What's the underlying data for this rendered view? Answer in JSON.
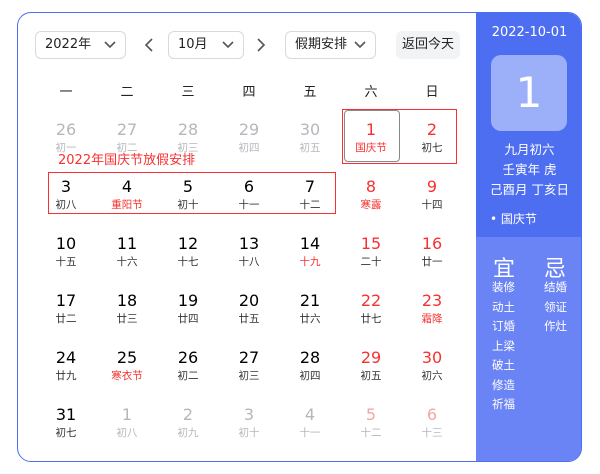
{
  "toolbar": {
    "year": "2022年",
    "month": "10月",
    "holiday_select": "假期安排",
    "today_button": "返回今天"
  },
  "weekdays": [
    "一",
    "二",
    "三",
    "四",
    "五",
    "六",
    "日"
  ],
  "annotation": "2022年国庆节放假安排",
  "weeks": [
    [
      {
        "d": "26",
        "l": "初一",
        "other": true
      },
      {
        "d": "27",
        "l": "初二",
        "other": true
      },
      {
        "d": "28",
        "l": "初三",
        "other": true
      },
      {
        "d": "29",
        "l": "初四",
        "other": true
      },
      {
        "d": "30",
        "l": "初五",
        "other": true
      },
      {
        "d": "1",
        "l": "国庆节",
        "wkend": true,
        "lred": true
      },
      {
        "d": "2",
        "l": "初七",
        "wkend": true
      }
    ],
    [
      {
        "d": "3",
        "l": "初八"
      },
      {
        "d": "4",
        "l": "重阳节",
        "lred": true
      },
      {
        "d": "5",
        "l": "初十"
      },
      {
        "d": "6",
        "l": "十一"
      },
      {
        "d": "7",
        "l": "十二"
      },
      {
        "d": "8",
        "l": "寒露",
        "wkend": true,
        "lred": true
      },
      {
        "d": "9",
        "l": "十四",
        "wkend": true
      }
    ],
    [
      {
        "d": "10",
        "l": "十五"
      },
      {
        "d": "11",
        "l": "十六"
      },
      {
        "d": "12",
        "l": "十七"
      },
      {
        "d": "13",
        "l": "十八"
      },
      {
        "d": "14",
        "l": "十九",
        "lred": true
      },
      {
        "d": "15",
        "l": "二十",
        "wkend": true
      },
      {
        "d": "16",
        "l": "廿一",
        "wkend": true
      }
    ],
    [
      {
        "d": "17",
        "l": "廿二"
      },
      {
        "d": "18",
        "l": "廿三"
      },
      {
        "d": "19",
        "l": "廿四"
      },
      {
        "d": "20",
        "l": "廿五"
      },
      {
        "d": "21",
        "l": "廿六"
      },
      {
        "d": "22",
        "l": "廿七",
        "wkend": true
      },
      {
        "d": "23",
        "l": "霜降",
        "wkend": true,
        "lred": true
      }
    ],
    [
      {
        "d": "24",
        "l": "廿九"
      },
      {
        "d": "25",
        "l": "寒衣节",
        "lred": true
      },
      {
        "d": "26",
        "l": "初二"
      },
      {
        "d": "27",
        "l": "初三"
      },
      {
        "d": "28",
        "l": "初四"
      },
      {
        "d": "29",
        "l": "初五",
        "wkend": true
      },
      {
        "d": "30",
        "l": "初六",
        "wkend": true
      }
    ],
    [
      {
        "d": "31",
        "l": "初七"
      },
      {
        "d": "1",
        "l": "初八",
        "other": true
      },
      {
        "d": "2",
        "l": "初九",
        "other": true
      },
      {
        "d": "3",
        "l": "初十",
        "other": true
      },
      {
        "d": "4",
        "l": "十一",
        "other": true
      },
      {
        "d": "5",
        "l": "十二",
        "other": true,
        "wkend": true
      },
      {
        "d": "6",
        "l": "十三",
        "other": true,
        "wkend": true
      }
    ]
  ],
  "detail": {
    "date": "2022-10-01",
    "day": "1",
    "lunar_date": "九月初六",
    "year_gz": "壬寅年 虎",
    "month_day_gz": "己酉月 丁亥日",
    "festival": "• 国庆节",
    "yi_label": "宜",
    "ji_label": "忌",
    "yi": [
      "装修",
      "动土",
      "订婚",
      "上梁",
      "破土",
      "修造",
      "祈福"
    ],
    "ji": [
      "结婚",
      "领证",
      "作灶"
    ]
  },
  "colors": {
    "accent": "#4e6ef2",
    "holiday_red": "#f73131",
    "panel_light": "#6b84f5",
    "big_date_box": "#9bb0f8"
  },
  "icons": {
    "dropdown": "chevron-down-icon",
    "prev": "chevron-left-icon",
    "next": "chevron-right-icon"
  }
}
